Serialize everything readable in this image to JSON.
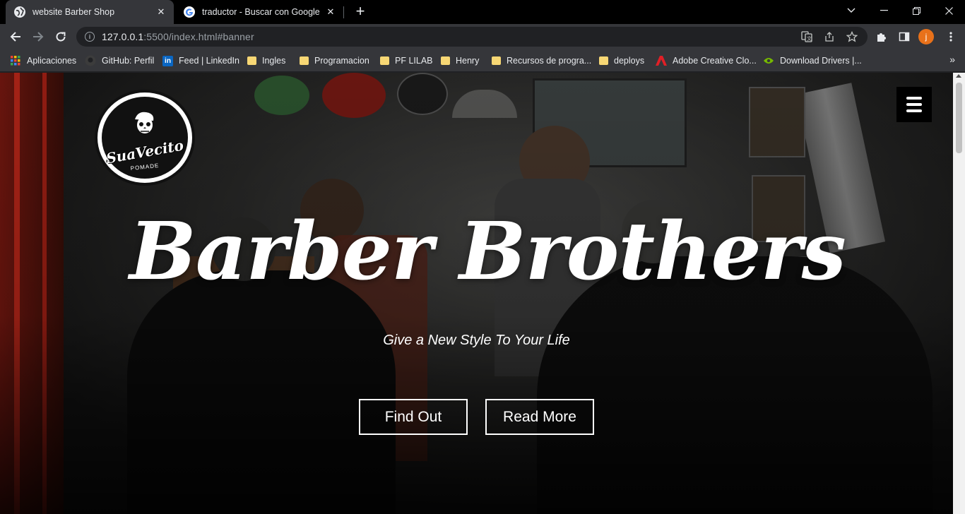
{
  "browser": {
    "tabs": [
      {
        "title": "website Barber Shop",
        "favicon": "globe-icon",
        "active": true
      },
      {
        "title": "traductor - Buscar con Google",
        "favicon": "google-icon",
        "active": false
      }
    ],
    "address": {
      "host": "127.0.0.1",
      "rest": ":5500/index.html#banner"
    },
    "profile_initial": "j",
    "bookmarks": [
      {
        "label": "Aplicaciones",
        "icon": "apps-grid-icon"
      },
      {
        "label": "GitHub: Perfil",
        "icon": "github-icon"
      },
      {
        "label": "Feed | LinkedIn",
        "icon": "linkedin-icon"
      },
      {
        "label": "Ingles",
        "icon": "folder-icon"
      },
      {
        "label": "Programacion",
        "icon": "folder-icon"
      },
      {
        "label": "PF LILAB",
        "icon": "folder-icon"
      },
      {
        "label": "Henry",
        "icon": "folder-icon"
      },
      {
        "label": "Recursos de progra...",
        "icon": "folder-icon"
      },
      {
        "label": "deploys",
        "icon": "folder-icon"
      },
      {
        "label": "Adobe Creative Clo...",
        "icon": "adobe-icon"
      },
      {
        "label": "Download Drivers |...",
        "icon": "nvidia-icon"
      }
    ]
  },
  "page": {
    "logo_text": "SuaVecito",
    "logo_sub": "POMADE",
    "title": "Barber Brothers",
    "subtitle": "Give a New Style To Your Life",
    "buttons": {
      "find_out": "Find Out",
      "read_more": "Read More"
    }
  },
  "colors": {
    "chrome_dark": "#000000",
    "chrome_toolbar": "#35363a",
    "omnibox": "#202124",
    "profile": "#e8711a",
    "folder": "#f7d774"
  }
}
